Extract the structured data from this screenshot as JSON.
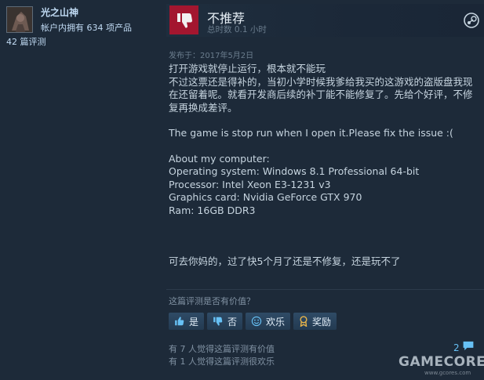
{
  "user": {
    "name": "光之山神",
    "products": "帐户内拥有 634 项产品",
    "reviews": "42 篇评测"
  },
  "review": {
    "verdict": "不推荐",
    "playtime": "总时数 0.1 小时",
    "posted": "发布于：2017年5月2日",
    "paragraphs": [
      "打开游戏就停止运行，根本就不能玩\n不过这票还是得补的，当初小学时候我爹给我买的这游戏的盗版盘我现在还留着呢。就看开发商后续的补丁能不能修复了。先给个好评，不修复再换成差评。",
      "The game is stop run when I open it.Please fix the issue :(",
      "About my computer:\nOperating system: Windows 8.1 Professional 64-bit\nProcessor: Intel Xeon E3-1231 v3\nGraphics card: Nvidia GeForce GTX 970\nRam: 16GB DDR3",
      "可去你妈的，过了快5个月了还是不修复，还是玩不了"
    ]
  },
  "feedback": {
    "question": "这篇评测是否有价值？",
    "yes_label": "是",
    "no_label": "否",
    "funny_label": "欢乐",
    "award_label": "奖励",
    "helpful_stat": "有 7 人觉得这篇评测有价值",
    "funny_stat": "有 1 人觉得这篇评测很欢乐",
    "comment_count": "2"
  },
  "watermark": {
    "brand": "GAMECORES",
    "url": "www.gcores.com"
  },
  "colors": {
    "background": "#1d2a39",
    "thumb_down_bg": "#a3162f",
    "link_blue": "#67c1f5",
    "text": "#c6d4df"
  },
  "icons": {
    "thumb": "thumbs-down-icon",
    "steam": "steam-logo-icon",
    "yes": "thumbs-up-icon",
    "no": "thumbs-down-icon",
    "funny": "smiley-icon",
    "award": "award-icon",
    "comments": "comment-bubble-icon"
  }
}
